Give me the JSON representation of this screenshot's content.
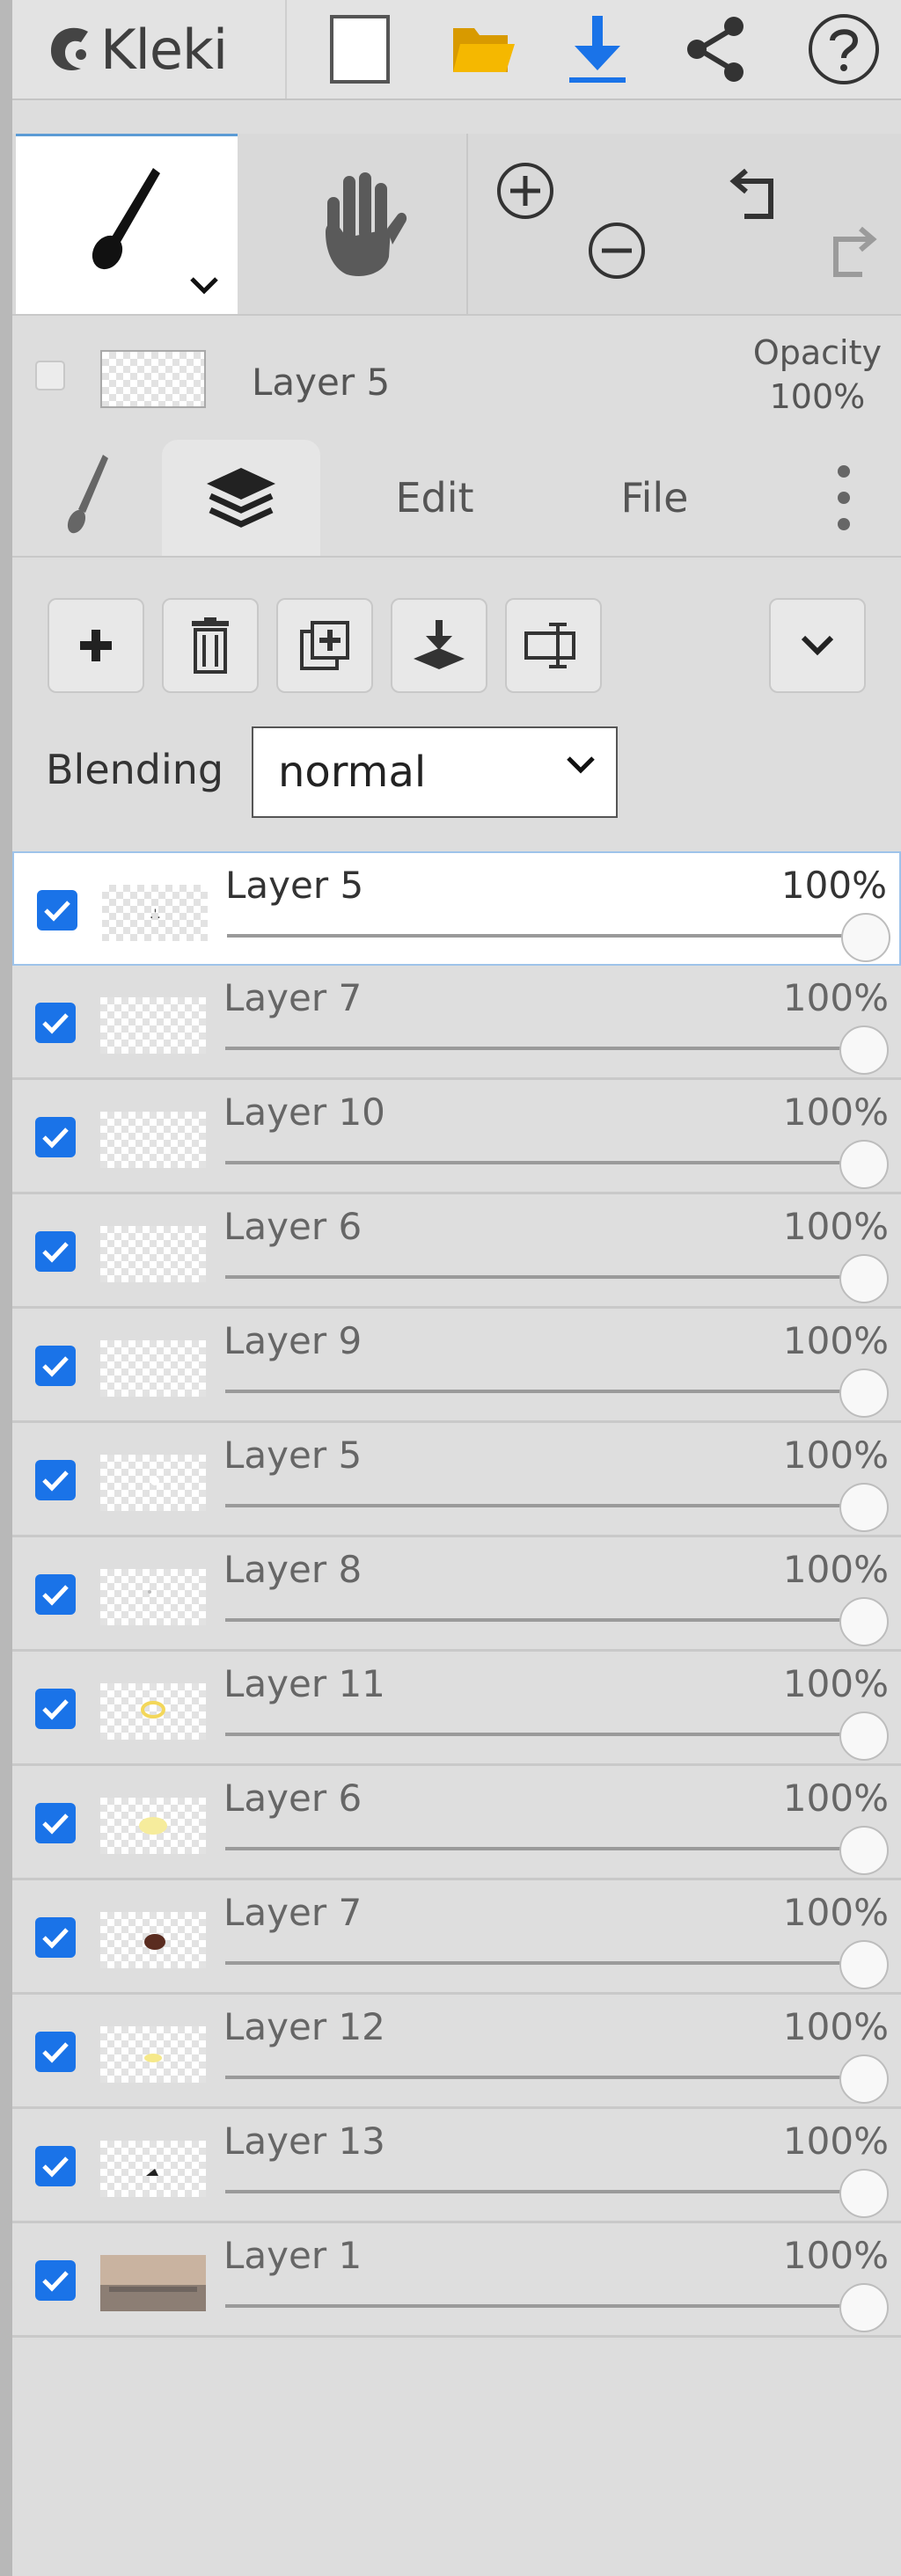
{
  "app": {
    "name": "Kleki"
  },
  "icons": {
    "new": "new-image-icon",
    "open": "open-folder-icon",
    "save": "download-icon",
    "share": "share-icon",
    "help": "help-icon",
    "brush": "brush-icon",
    "hand": "hand-icon",
    "zoom_in": "zoom-in-icon",
    "zoom_out": "zoom-out-icon",
    "undo": "undo-icon",
    "redo": "redo-icon"
  },
  "colors": {
    "accent": "#1a73e8",
    "folder": "#f5b800",
    "active_border": "#9ec3ea"
  },
  "current_layer": {
    "name": "Layer 5",
    "opacity_label": "Opacity",
    "opacity_value": "100%"
  },
  "tabs": {
    "edit": "Edit",
    "file": "File"
  },
  "blending": {
    "label": "Blending",
    "value": "normal"
  },
  "layers": [
    {
      "name": "Layer 5",
      "opacity": "100%",
      "active": true
    },
    {
      "name": "Layer 7",
      "opacity": "100%"
    },
    {
      "name": "Layer 10",
      "opacity": "100%"
    },
    {
      "name": "Layer 6",
      "opacity": "100%"
    },
    {
      "name": "Layer 9",
      "opacity": "100%"
    },
    {
      "name": "Layer 5",
      "opacity": "100%"
    },
    {
      "name": "Layer 8",
      "opacity": "100%"
    },
    {
      "name": "Layer 11",
      "opacity": "100%"
    },
    {
      "name": "Layer 6",
      "opacity": "100%"
    },
    {
      "name": "Layer 7",
      "opacity": "100%"
    },
    {
      "name": "Layer 12",
      "opacity": "100%"
    },
    {
      "name": "Layer 13",
      "opacity": "100%"
    },
    {
      "name": "Layer 1",
      "opacity": "100%"
    }
  ]
}
